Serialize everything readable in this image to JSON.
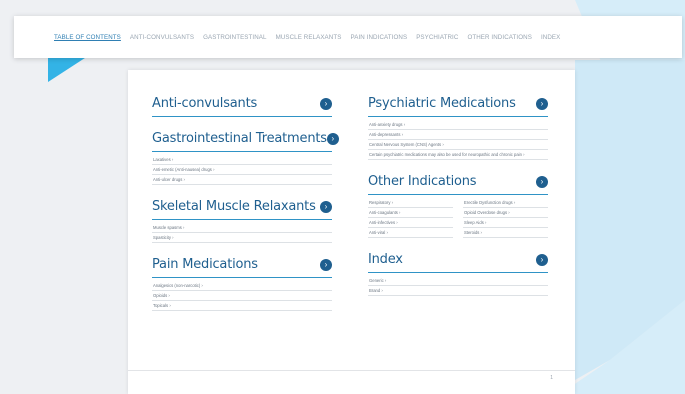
{
  "nav": {
    "items": [
      "TABLE OF CONTENTS",
      "ANTI-CONVULSANTS",
      "GASTROINTESTINAL",
      "MUSCLE RELAXANTS",
      "PAIN INDICATIONS",
      "PSYCHIATRIC",
      "OTHER INDICATIONS",
      "INDEX"
    ],
    "active_index": 0
  },
  "left_sections": [
    {
      "title": "Anti-convulsants",
      "items": []
    },
    {
      "title": "Gastrointestinal Treatments",
      "items": [
        "Laxatives",
        "Anti-emetic (Anti-nausea) drugs",
        "Anti-ulcer drugs"
      ]
    },
    {
      "title": "Skeletal Muscle Relaxants",
      "items": [
        "Muscle spasms",
        "Spasticity"
      ]
    },
    {
      "title": "Pain Medications",
      "items": [
        "Analgesics (non-narcotic)",
        "Opioids",
        "Topicals"
      ]
    }
  ],
  "right_sections": {
    "psychiatric": {
      "title": "Psychiatric Medications",
      "items": [
        "Anti-anxiety drugs",
        "Anti-depressants",
        "Central Nervous System (CNS) Agents",
        "Certain psychiatric medications may also be used for neuropathic and chronic pain"
      ]
    },
    "other": {
      "title": "Other Indications",
      "col1": [
        "Respiratory",
        "Anti-coagulants",
        "Anti-infectives",
        "Anti-viral"
      ],
      "col2": [
        "Erectile Dysfunction drugs",
        "Opioid Overdose drugs",
        "Sleep Aids",
        "Steroids"
      ]
    },
    "index": {
      "title": "Index",
      "items": [
        "Generic",
        "Brand"
      ]
    }
  },
  "footer": {
    "page_number": "1"
  },
  "colors": {
    "accent": "#2f93c6",
    "heading": "#1f5f8f",
    "pointer": "#33b3e6",
    "backdrop": "#cfe9f7"
  },
  "icons": {
    "go": "arrow-circle-right-icon",
    "item_arrow": "chevron-right-icon"
  }
}
